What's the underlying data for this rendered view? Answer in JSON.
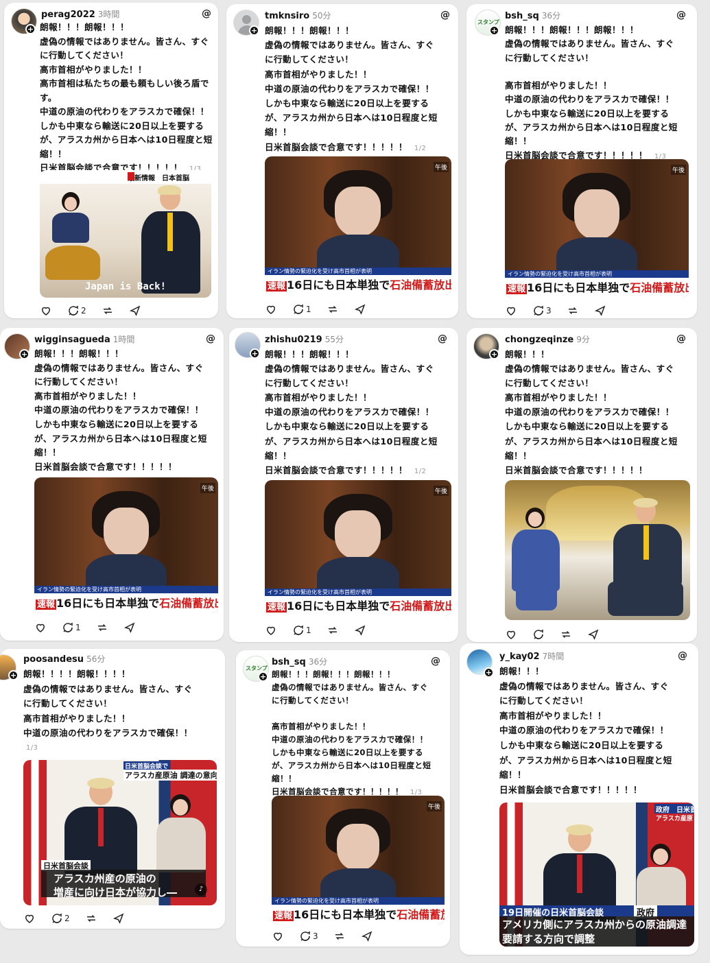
{
  "threads_icon": "threads-logo-icon",
  "posts": [
    {
      "username": "perag2022",
      "time": "3時間",
      "lines": [
        "朗報！！！朗報！！！",
        "虚偽の情報ではありません。皆さん、すぐ",
        "に行動してください！",
        "高市首相がやりました！！",
        "高市首相は私たちの最も頼もしい後ろ盾で",
        "す。",
        "中道の原油の代わりをアラスカで確保！！",
        "しかも中東なら輸送に20日以上を要する",
        "が、アラスカ州から日本へは10日程度と短",
        "縮！！",
        "日米首脳会談で合意です！！！！！"
      ],
      "page": "1/3",
      "media_caption": "Japan is Back!",
      "media_label": "最新情報　日本首脳",
      "reply_count": "2"
    },
    {
      "username": "tmknsiro",
      "time": "50分",
      "lines": [
        "朗報！！！朗報！！！",
        "虚偽の情報ではありません。皆さん、すぐ",
        "に行動してください！",
        "高市首相がやりました！！",
        "中道の原油の代わりをアラスカで確保！！",
        "しかも中東なら輸送に20日以上を要する",
        "が、アラスカ州から日本へは10日程度と短",
        "縮！！",
        "日米首脳会談で合意です！！！！！"
      ],
      "page": "1/2",
      "news_top": "イラン情勢の緊迫化を受け高市首相が表明",
      "news_tag": "速報",
      "news_main_a": "16日にも日本単独で",
      "news_main_b": "石油備蓄放出",
      "news_corner": "午後",
      "reply_count": "1"
    },
    {
      "username": "bsh_sq",
      "time": "36分",
      "lines": [
        "朗報！！！朗報！！！朗報！！！",
        "虚偽の情報ではありません。皆さん、すぐ",
        "に行動してください！",
        "",
        "高市首相がやりました！！",
        "中道の原油の代わりをアラスカで確保！！",
        "しかも中東なら輸送に20日以上を要する",
        "が、アラスカ州から日本へは10日程度と短",
        "縮！！",
        "日米首脳会談で合意です！！！！！"
      ],
      "page": "1/3",
      "news_top": "イラン情勢の緊迫化を受け高市首相が表明",
      "news_tag": "速報",
      "news_main_a": "16日にも日本単独で",
      "news_main_b": "石油備蓄放出",
      "news_corner": "午後",
      "reply_count": "3"
    },
    {
      "username": "wigginsagueda",
      "time": "1時間",
      "lines": [
        "朗報！！！朗報！！！",
        "虚偽の情報ではありません。皆さん、すぐ",
        "に行動してください！",
        "高市首相がやりました！！",
        "中道の原油の代わりをアラスカで確保！！",
        "しかも中東なら輸送に20日以上を要する",
        "が、アラスカ州から日本へは10日程度と短",
        "縮！！",
        "日米首脳会談で合意です！！！！！"
      ],
      "page": "",
      "news_top": "イラン情勢の緊迫化を受け高市首相が表明",
      "news_tag": "速報",
      "news_main_a": "16日にも日本単独で",
      "news_main_b": "石油備蓄放出",
      "news_corner": "午後",
      "reply_count": "1"
    },
    {
      "username": "zhishu0219",
      "time": "55分",
      "lines": [
        "朗報！！！朗報！！！",
        "虚偽の情報ではありません。皆さん、すぐ",
        "に行動してください！",
        "高市首相がやりました！！",
        "中道の原油の代わりをアラスカで確保！！",
        "しかも中東なら輸送に20日以上を要する",
        "が、アラスカ州から日本へは10日程度と短",
        "縮！！",
        "日米首脳会談で合意です！！！！！"
      ],
      "page": "1/2",
      "news_top": "イラン情勢の緊迫化を受け高市首相が表明",
      "news_tag": "速報",
      "news_main_a": "16日にも日本単独で",
      "news_main_b": "石油備蓄放出",
      "news_corner": "午後",
      "reply_count": "1"
    },
    {
      "username": "chongzeqinze",
      "time": "9分",
      "lines": [
        "朗報！！！",
        "虚偽の情報ではありません。皆さん、すぐ",
        "に行動してください！",
        "高市首相がやりました！！",
        "中道の原油の代わりをアラスカで確保！！",
        "しかも中東なら輸送に20日以上を要する",
        "が、アラスカ州から日本へは10日程度と短",
        "縮！！",
        "日米首脳会談で合意です！！！！！"
      ],
      "page": "",
      "reply_count": ""
    },
    {
      "username": "poosandesu",
      "time": "56分",
      "lines": [
        "朗報！！！！朗報！！！！",
        "虚偽の情報ではありません。皆さん、すぐ",
        "に行動してください！",
        "高市首相がやりました！！",
        "中道の原油の代わりをアラスカで確保！！"
      ],
      "page": "1/3",
      "cap_top_a": "日米首脳会談で",
      "cap_top_b": "アラスカ産原油 調達の意向",
      "cap_small": "日米首脳会談",
      "cap_big_1": "アラスカ州産の原油の",
      "cap_big_2": "増産に向け日本が協力し―",
      "reply_count": "2"
    },
    {
      "username": "bsh_sq",
      "time": "36分",
      "lines": [
        "朗報！！！朗報！！！朗報！！！",
        "虚偽の情報ではありません。皆さん、すぐ",
        "に行動してください！",
        "",
        "高市首相がやりました！！",
        "中道の原油の代わりをアラスカで確保！！",
        "しかも中東なら輸送に20日以上を要する",
        "が、アラスカ州から日本へは10日程度と短",
        "縮！！",
        "日米首脳会談で合意です！！！！！"
      ],
      "page": "1/3",
      "news_top": "イラン情勢の緊迫化を受け高市首相が表明",
      "news_tag": "速報",
      "news_main_a": "16日にも日本単独で",
      "news_main_b": "石油備蓄放出",
      "news_corner": "午後",
      "reply_count": "3"
    },
    {
      "username": "y_kay02",
      "time": "7時間",
      "lines": [
        "朗報！！！",
        "虚偽の情報ではありません。皆さん、すぐ",
        "に行動してください！",
        "高市首相がやりました！！",
        "中道の原油の代わりをアラスカで確保！！",
        "しかも中東なら輸送に20日以上を要する",
        "が、アラスカ州から日本へは10日程度と短",
        "縮！！",
        "日米首脳会談で合意です！！！！！"
      ],
      "page": "",
      "cap_top_a": "政府　日米首",
      "cap_top_b": "アラスカ産原",
      "cap_blue_a": "19日開催の日米首脳会談",
      "cap_blue_b": "政府",
      "cap_big_1": "アメリカ側にアラスカ州からの原油調達",
      "cap_big_2": "要請する方向で調整",
      "reply_count": ""
    }
  ]
}
